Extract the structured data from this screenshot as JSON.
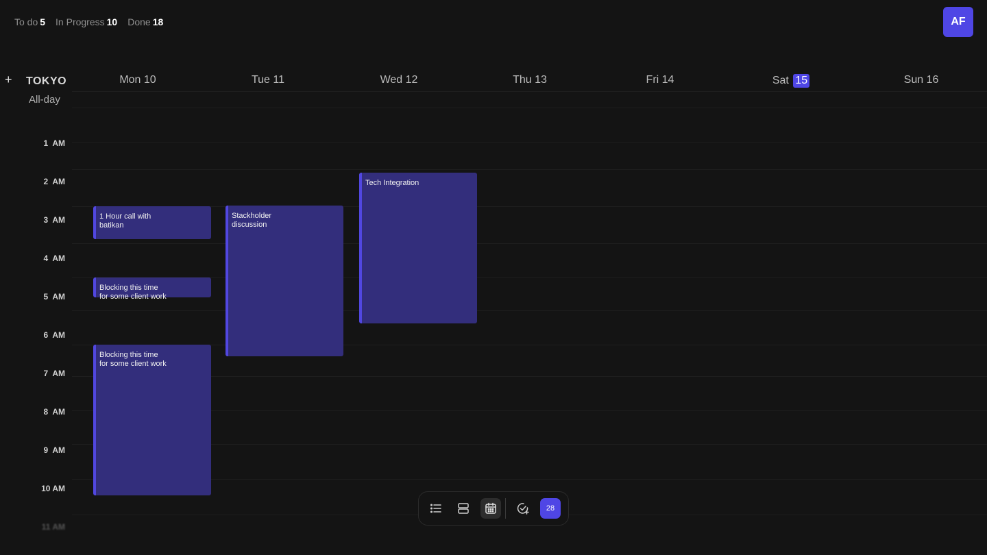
{
  "stats": [
    {
      "label": "To do",
      "value": "5"
    },
    {
      "label": "In Progress",
      "value": "10"
    },
    {
      "label": "Done",
      "value": "18"
    }
  ],
  "user": {
    "initials": "AF"
  },
  "calendar": {
    "add_symbol": "+",
    "timezone": "TOKYO",
    "all_day_label": "All-day",
    "days": [
      {
        "name": "Mon",
        "num": "10",
        "today": false
      },
      {
        "name": "Tue",
        "num": "11",
        "today": false
      },
      {
        "name": "Wed",
        "num": "12",
        "today": false
      },
      {
        "name": "Thu",
        "num": "13",
        "today": false
      },
      {
        "name": "Fri",
        "num": "14",
        "today": false
      },
      {
        "name": "Sat",
        "num": "15",
        "today": true
      },
      {
        "name": "Sun",
        "num": "16",
        "today": false
      }
    ],
    "hours": [
      "1  AM",
      "2  AM",
      "3  AM",
      "4  AM",
      "5  AM",
      "6  AM",
      "7  AM",
      "8  AM",
      "9  AM",
      "10 AM",
      "11 AM"
    ],
    "events": [
      {
        "title": "1 Hour call with\nbatikan",
        "day": "Mon 10"
      },
      {
        "title": "Blocking this time\nfor some client work",
        "day": "Mon 10"
      },
      {
        "title": "Blocking this time\nfor some client work",
        "day": "Mon 10"
      },
      {
        "title": "Stackholder\ndiscussion",
        "day": "Tue 11"
      },
      {
        "title": "Tech Integration",
        "day": "Wed 12"
      }
    ]
  },
  "toolbar": {
    "items": [
      {
        "icon": "list-icon",
        "active": false
      },
      {
        "icon": "split-view-icon",
        "active": false
      },
      {
        "icon": "calendar-icon",
        "active": true
      },
      {
        "icon": "check-add-icon",
        "active": false
      }
    ],
    "count": "28"
  },
  "colors": {
    "accent": "#4f46e5",
    "event_bg": "#332e7c",
    "background": "#141414"
  }
}
